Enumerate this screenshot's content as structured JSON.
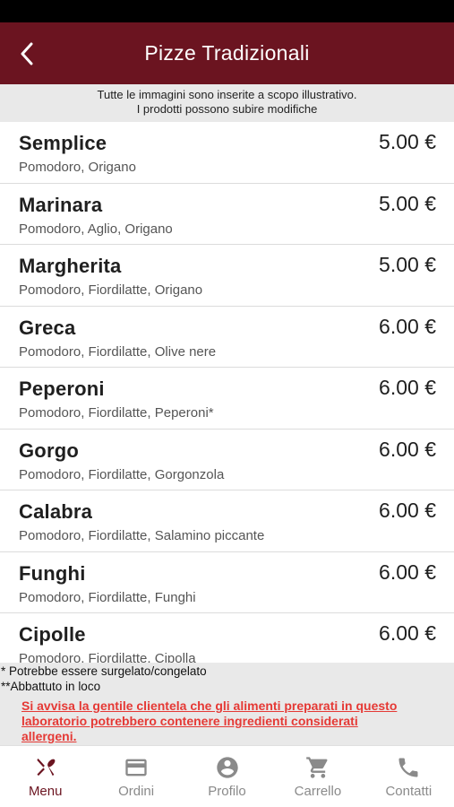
{
  "header": {
    "title": "Pizze Tradizionali"
  },
  "notice": {
    "line1": "Tutte le immagini sono inserite a scopo illustrativo.",
    "line2": "I prodotti possono subire modifiche"
  },
  "items": [
    {
      "name": "Semplice",
      "desc": "Pomodoro, Origano",
      "price": "5.00 €"
    },
    {
      "name": "Marinara",
      "desc": "Pomodoro, Aglio, Origano",
      "price": "5.00 €"
    },
    {
      "name": "Margherita",
      "desc": "Pomodoro, Fiordilatte, Origano",
      "price": "5.00 €"
    },
    {
      "name": "Greca",
      "desc": "Pomodoro, Fiordilatte, Olive nere",
      "price": "6.00 €"
    },
    {
      "name": "Peperoni",
      "desc": "Pomodoro, Fiordilatte, Peperoni*",
      "price": "6.00 €"
    },
    {
      "name": "Gorgo",
      "desc": "Pomodoro, Fiordilatte, Gorgonzola",
      "price": "6.00 €"
    },
    {
      "name": "Calabra",
      "desc": "Pomodoro, Fiordilatte, Salamino piccante",
      "price": "6.00 €"
    },
    {
      "name": "Funghi",
      "desc": "Pomodoro, Fiordilatte, Funghi",
      "price": "6.00 €"
    },
    {
      "name": "Cipolle",
      "desc": "Pomodoro, Fiordilatte, Cipolla",
      "price": "6.00 €"
    }
  ],
  "footer": {
    "note1": "* Potrebbe essere surgelato/congelato",
    "note2": "**Abbattuto in loco",
    "warning": "Si avvisa la gentile clientela che gli alimenti preparati in questo laboratorio potrebbero contenere ingredienti considerati allergeni."
  },
  "tabs": [
    {
      "label": "Menu",
      "icon": "cutlery-icon"
    },
    {
      "label": "Ordini",
      "icon": "credit-card-icon"
    },
    {
      "label": "Profilo",
      "icon": "account-icon"
    },
    {
      "label": "Carrello",
      "icon": "cart-icon"
    },
    {
      "label": "Contatti",
      "icon": "phone-icon"
    }
  ],
  "colors": {
    "brand": "#6b1420",
    "warning": "#e53935",
    "inactive": "#8a8a8a"
  }
}
